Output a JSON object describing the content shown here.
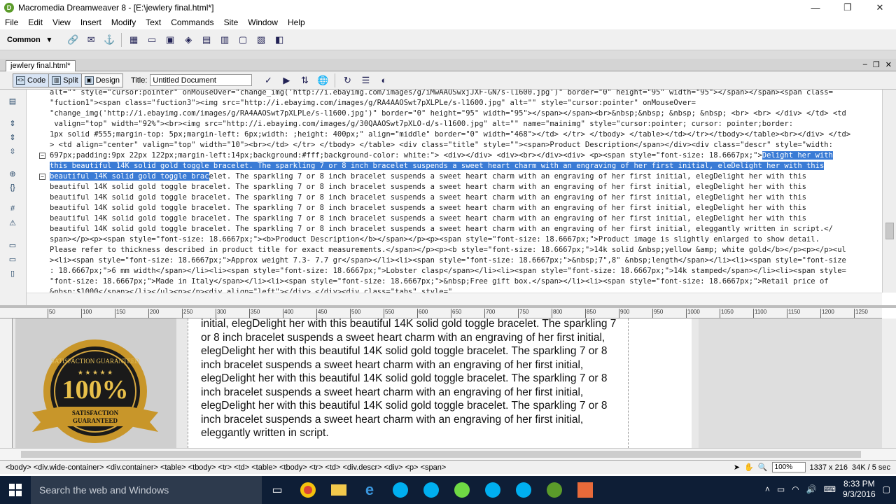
{
  "window": {
    "title": "Macromedia Dreamweaver 8 - [E:\\jewlery final.html*]"
  },
  "menu": [
    "File",
    "Edit",
    "View",
    "Insert",
    "Modify",
    "Text",
    "Commands",
    "Site",
    "Window",
    "Help"
  ],
  "insert_bar": {
    "category": "Common"
  },
  "document": {
    "tab": "jewlery final.html*"
  },
  "view_buttons": {
    "code": "Code",
    "split": "Split",
    "design": "Design"
  },
  "title_field": {
    "label": "Title:",
    "value": "Untitled Document"
  },
  "code_lines": [
    {
      "pre": "alt=\"\" style=\"cursor:pointer\" onMouseOver=\"change_img('http://i.ebayimg.com/images/g/iMwAAOSwxjJXF-GN/s-l1600.jpg')\" border=\"0\" height=\"95\" width=\"95\"></span></span><span class=",
      "hl": "",
      "post": ""
    },
    {
      "pre": "\"fuction1\"><span class=\"fuction3\"><img src=\"http://i.ebayimg.com/images/g/RA4AAOSwt7pXLPLe/s-l1600.jpg\" alt=\"\" style=\"cursor:pointer\" onMouseOver=",
      "hl": "",
      "post": ""
    },
    {
      "pre": "\"change_img('http://i.ebayimg.com/images/g/RA4AAOSwt7pXLPLe/s-l1600.jpg')\" border=\"0\" height=\"95\" width=\"95\"></span></span><br>&nbsp;&nbsp; &nbsp; &nbsp; <br> <br> </div> </td> <td",
      "hl": "",
      "post": ""
    },
    {
      "pre": " valign=\"top\" width=\"92%\"><br><img src=\"http://i.ebayimg.com/images/g/30QAAOSwt7pXLO-d/s-l1600.jpg\" alt=\"\" name=\"mainimg\" style=\"cursor:pointer; cursor: pointer;border:",
      "hl": "",
      "post": ""
    },
    {
      "pre": "1px solid #555;margin-top: 5px;margin-left: 6px;width: ;height: 400px;\" align=\"middle\" border=\"0\" width=\"468\"></td> </tr> </tbody> </table></td></tr></tbody></table><br></div> </td>",
      "hl": "",
      "post": ""
    },
    {
      "pre": "> <td align=\"center\" valign=\"top\" width=\"10\"><br></td> </tr> </tbody> </table> <div class=\"title\" style=\"\"><span>Product Description</span></div><div class=\"descr\" style=\"width:",
      "hl": "",
      "post": ""
    },
    {
      "pre": "697px;padding:9px 22px 122px;margin-left:14px;background:#fff;background-color: white:\"> <div></div> <div><br></div><div> <p><span style=\"font-size: 18.6667px;\">",
      "hl": "Delight her with",
      "post": "",
      "fold": true
    },
    {
      "pre": "",
      "hl": "this beautiful 14K solid gold toggle bracelet. The sparkling 7 or 8 inch bracelet suspends a sweet heart charm with an engraving of her first initial, eleDelight her with this",
      "post": ""
    },
    {
      "pre": "",
      "hl": "beautiful 14K solid gold toggle brac",
      "post": "elet. The sparkling 7 or 8 inch bracelet suspends a sweet heart charm with an engraving of her first initial, elegDelight her with this",
      "fold": true
    },
    {
      "pre": "beautiful 14K solid gold toggle bracelet. The sparkling 7 or 8 inch bracelet suspends a sweet heart charm with an engraving of her first initial, elegDelight her with this",
      "hl": "",
      "post": ""
    },
    {
      "pre": "beautiful 14K solid gold toggle bracelet. The sparkling 7 or 8 inch bracelet suspends a sweet heart charm with an engraving of her first initial, elegDelight her with this",
      "hl": "",
      "post": ""
    },
    {
      "pre": "beautiful 14K solid gold toggle bracelet. The sparkling 7 or 8 inch bracelet suspends a sweet heart charm with an engraving of her first initial, elegDelight her with this",
      "hl": "",
      "post": ""
    },
    {
      "pre": "beautiful 14K solid gold toggle bracelet. The sparkling 7 or 8 inch bracelet suspends a sweet heart charm with an engraving of her first initial, elegDelight her with this",
      "hl": "",
      "post": ""
    },
    {
      "pre": "beautiful 14K solid gold toggle bracelet. The sparkling 7 or 8 inch bracelet suspends a sweet heart charm with an engraving of her first initial, eleggantly written in script.</",
      "hl": "",
      "post": ""
    },
    {
      "pre": "span></p><p><span style=\"font-size: 18.6667px;\"><b>Product Description</b></span></p><p><span style=\"font-size: 18.6667px;\">Product image is slightly enlarged to show detail.",
      "hl": "",
      "post": ""
    },
    {
      "pre": "Please refer to thickness described in product title for exact measurements.</span></p><p><b style=\"font-size: 18.6667px;\">14k solid &nbsp;yellow &amp; white gold</b></p><p></p><ul",
      "hl": "",
      "post": ""
    },
    {
      "pre": "><li><span style=\"font-size: 18.6667px;\">Approx weight 7.3- 7.7 gr</span></li><li><span style=\"font-size: 18.6667px;\">&nbsp;7\",8\" &nbsp;length</span></li><li><span style=\"font-size",
      "hl": "",
      "post": ""
    },
    {
      "pre": ": 18.6667px;\">6 mm width</span></li><li><span style=\"font-size: 18.6667px;\">Lobster clasp</span></li><li><span style=\"font-size: 18.6667px;\">14k stamped</span></li><li><span style=",
      "hl": "",
      "post": ""
    },
    {
      "pre": "\"font-size: 18.6667px;\">Made in Italy</span></li><li><span style=\"font-size: 18.6667px;\">&nbsp;Free gift box.</span></li><li><span style=\"font-size: 18.6667px;\">Retail price of",
      "hl": "",
      "post": ""
    },
    {
      "pre": "&nbsp;$1000</span></li></ul><p></p><div align=\"left\"></div> </div><div class=\"tabs\" style=\"",
      "hl": "",
      "post": ""
    }
  ],
  "ruler_marks": [
    "50",
    "100",
    "150",
    "200",
    "250",
    "300",
    "350",
    "400",
    "450",
    "500",
    "550",
    "600",
    "650",
    "700",
    "750",
    "800",
    "850",
    "900",
    "950",
    "1000",
    "1050",
    "1100",
    "1150",
    "1200",
    "1250"
  ],
  "badge": {
    "arc_text": "SATISFACTION GUARANTEED",
    "big": "100%",
    "ribbon_line1": "SATISFACTION",
    "ribbon_line2": "GUARANTEED",
    "stars": "★ ★ ★ ★ ★"
  },
  "design_text": "initial, elegDelight her with this beautiful 14K solid gold toggle bracelet. The sparkling 7 or 8 inch bracelet suspends a sweet heart charm with an engraving of her first initial, elegDelight her with this beautiful 14K solid gold toggle bracelet. The sparkling 7 or 8 inch bracelet suspends a sweet heart charm with an engraving of her first initial, elegDelight her with this beautiful 14K solid gold toggle bracelet. The sparkling 7 or 8 inch bracelet suspends a sweet heart charm with an engraving of her first initial, elegDelight her with this beautiful 14K solid gold toggle bracelet. The sparkling 7 or 8 inch bracelet suspends a sweet heart charm with an engraving of her first initial, eleggantly written in script.",
  "status": {
    "tag_selector": "<body> <div.wide-container> <div.container> <table> <tbody> <tr> <td> <table> <tbody> <tr> <td> <div.descr> <div> <p> <span>",
    "zoom": "100%",
    "dimensions": "1337 x 216",
    "filesize": "34K / 5 sec"
  },
  "taskbar": {
    "search_placeholder": "Search the web and Windows",
    "time": "8:33 PM",
    "date": "9/3/2016"
  },
  "colors": {
    "selection": "#3a7bd5",
    "taskbar": "#0e1e36"
  }
}
